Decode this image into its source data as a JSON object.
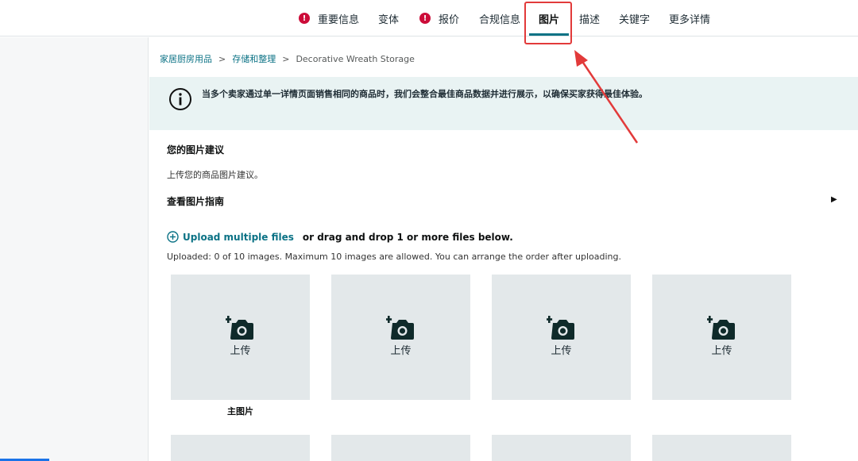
{
  "nav": {
    "tabs": [
      {
        "label": "重要信息",
        "error": true
      },
      {
        "label": "变体",
        "error": false
      },
      {
        "label": "报价",
        "error": true
      },
      {
        "label": "合规信息",
        "error": false
      },
      {
        "label": "图片",
        "error": false,
        "active": true
      },
      {
        "label": "描述",
        "error": false
      },
      {
        "label": "关键字",
        "error": false
      },
      {
        "label": "更多详情",
        "error": false
      }
    ],
    "error_glyph": "!"
  },
  "breadcrumb": {
    "items": [
      "家居厨房用品",
      "存储和整理"
    ],
    "current": "Decorative Wreath Storage",
    "separator": ">"
  },
  "banner": {
    "icon": "info-icon",
    "text": "当多个卖家通过单一详情页面销售相同的商品时，我们会整合最佳商品数据并进行展示，以确保买家获得最佳体验。"
  },
  "images": {
    "section_title": "您的图片建议",
    "section_desc": "上传您的商品图片建议。",
    "guide_title": "查看图片指南",
    "upload_link": "Upload multiple files",
    "upload_tail": "or drag and drop 1 or more files below.",
    "uploaded_info": "Uploaded: 0 of 10 images. Maximum 10 images are allowed. You can arrange the order after uploading.",
    "tiles": [
      {
        "label": "上传",
        "caption": "主图片"
      },
      {
        "label": "上传",
        "caption": ""
      },
      {
        "label": "上传",
        "caption": ""
      },
      {
        "label": "上传",
        "caption": ""
      }
    ]
  },
  "colors": {
    "accent": "#0b7285",
    "error": "#cc0c39",
    "annotation": "#e23a3a",
    "banner_bg": "#e9f3f3",
    "tile_bg": "#e3e8ea"
  }
}
